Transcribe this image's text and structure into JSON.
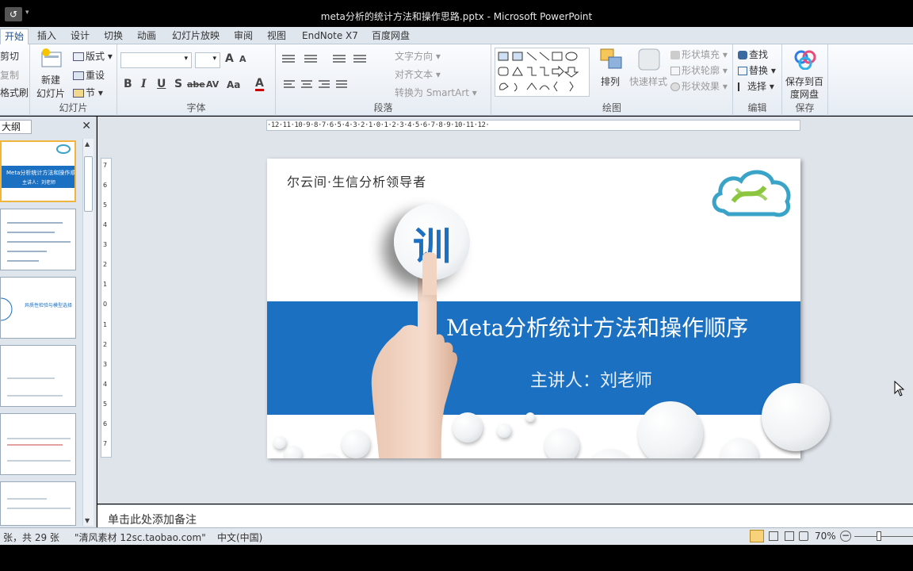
{
  "window": {
    "title": "meta分析的统计方法和操作思路.pptx - Microsoft PowerPoint",
    "undo_symbol": "↺",
    "qa_dropdown": "▾"
  },
  "tabs": [
    "开始",
    "插入",
    "设计",
    "切换",
    "动画",
    "幻灯片放映",
    "审阅",
    "视图",
    "EndNote X7",
    "百度网盘"
  ],
  "active_tab": "开始",
  "ribbon": {
    "clipboard": {
      "cut": "剪切",
      "copy": "复制",
      "format_painter": "格式刷"
    },
    "slides": {
      "label": "幻灯片",
      "new_slide_line1": "新建",
      "new_slide_line2": "幻灯片",
      "layout": "版式",
      "reset": "重设",
      "section": "节"
    },
    "font": {
      "label": "字体",
      "bold": "B",
      "italic": "I",
      "underline": "U",
      "shadow": "S",
      "strike": "abe",
      "spacing": "AV",
      "case": "Aa",
      "color": "A",
      "grow": "A",
      "shrink": "A"
    },
    "paragraph": {
      "label": "段落",
      "text_direction": "文字方向",
      "align_text": "对齐文本",
      "smartart": "转换为 SmartArt"
    },
    "drawing": {
      "label": "绘图",
      "arrange": "排列",
      "quick_styles": "快速样式",
      "shape_fill": "形状填充",
      "shape_outline": "形状轮廓",
      "shape_effects": "形状效果"
    },
    "editing": {
      "label": "编辑",
      "find": "查找",
      "replace": "替换",
      "select": "选择"
    },
    "save": {
      "label": "保存",
      "line1": "保存到百",
      "line2": "度网盘"
    }
  },
  "left_panel": {
    "tab": "大纲",
    "close": "✕",
    "thumb1_title": "Meta分析统计方法和操作顺序",
    "thumb1_sub": "主讲人：刘老师",
    "thumb3_title": "异质性检验与模型选择"
  },
  "slide": {
    "company": "尔云间·生信分析领导者",
    "badge_char": "训",
    "title": "Meta分析统计方法和操作顺序",
    "presenter": "主讲人：刘老师"
  },
  "ruler": {
    "h_ticks": "·12·11·10·9·8·7·6·5·4·3·2·1·0·1·2·3·4·5·6·7·8·9·10·11·12·",
    "v_ticks": [
      "7",
      "6",
      "5",
      "4",
      "3",
      "2",
      "1",
      "0",
      "1",
      "2",
      "3",
      "4",
      "5",
      "6",
      "7"
    ]
  },
  "notes_placeholder": "单击此处添加备注",
  "status": {
    "slide_info": "张，共 29 张",
    "theme": "\"清风素材 12sc.taobao.com\"",
    "language": "中文(中国)",
    "zoom": "70%"
  },
  "colors": {
    "accent_blue": "#1c70c2",
    "logo_teal": "#3aa3c8",
    "logo_green": "#8cc63f",
    "ribbon_bg": "#e6ecf3"
  }
}
